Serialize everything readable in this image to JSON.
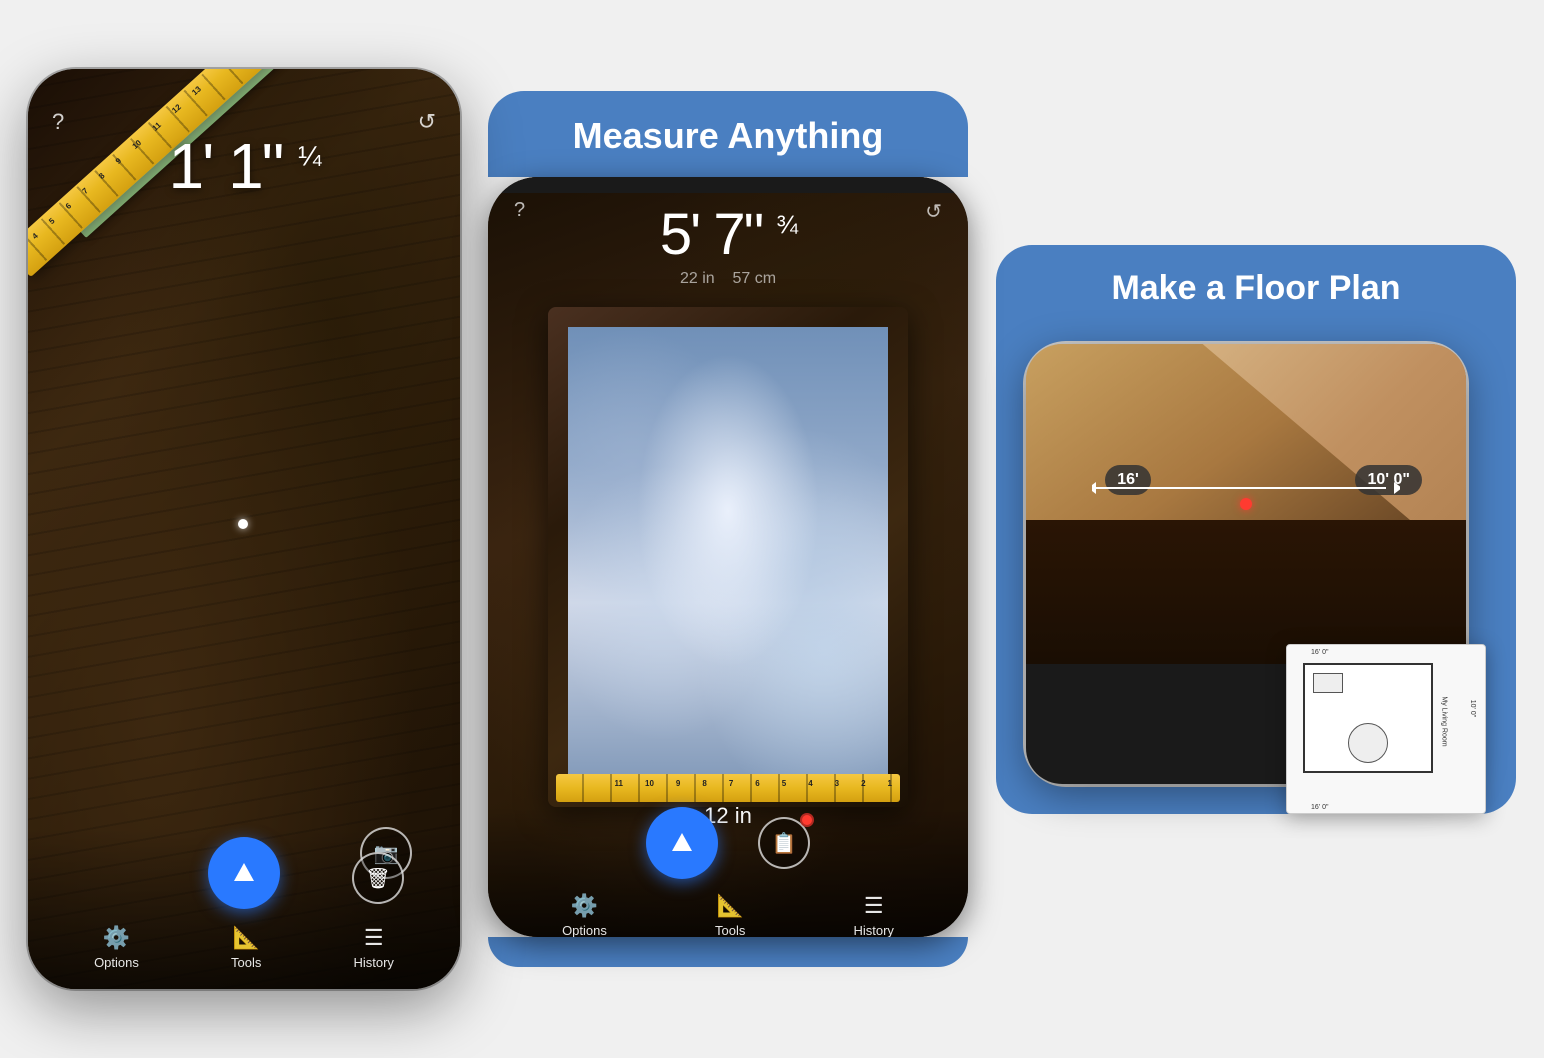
{
  "screen1": {
    "question_icon": "?",
    "refresh_icon": "↺",
    "measurement_feet": "1'",
    "measurement_inches": "1\"",
    "measurement_fraction": "¼",
    "tab_options": "Options",
    "tab_tools": "Tools",
    "tab_history": "History",
    "options_icon": "⚙",
    "tools_icon": "📐",
    "history_icon": "☰"
  },
  "screen2": {
    "header_title": "Measure Anything",
    "question_icon": "?",
    "refresh_icon": "↺",
    "measurement_feet": "5'",
    "measurement_inches": "7\"",
    "measurement_fraction": "¾",
    "measurement_in": "22 in",
    "measurement_cm": "57 cm",
    "frame_measurement": "12 in",
    "tab_options": "Options",
    "tab_tools": "Tools",
    "tab_history": "History"
  },
  "screen3": {
    "header_title": "Make a Floor Plan",
    "room_label_16": "16'",
    "room_label_10": "10' 0\"",
    "fp_measurement_top": "16' 0\"",
    "fp_measurement_side": "10' 0\"",
    "fp_room_name": "My Living Room"
  }
}
